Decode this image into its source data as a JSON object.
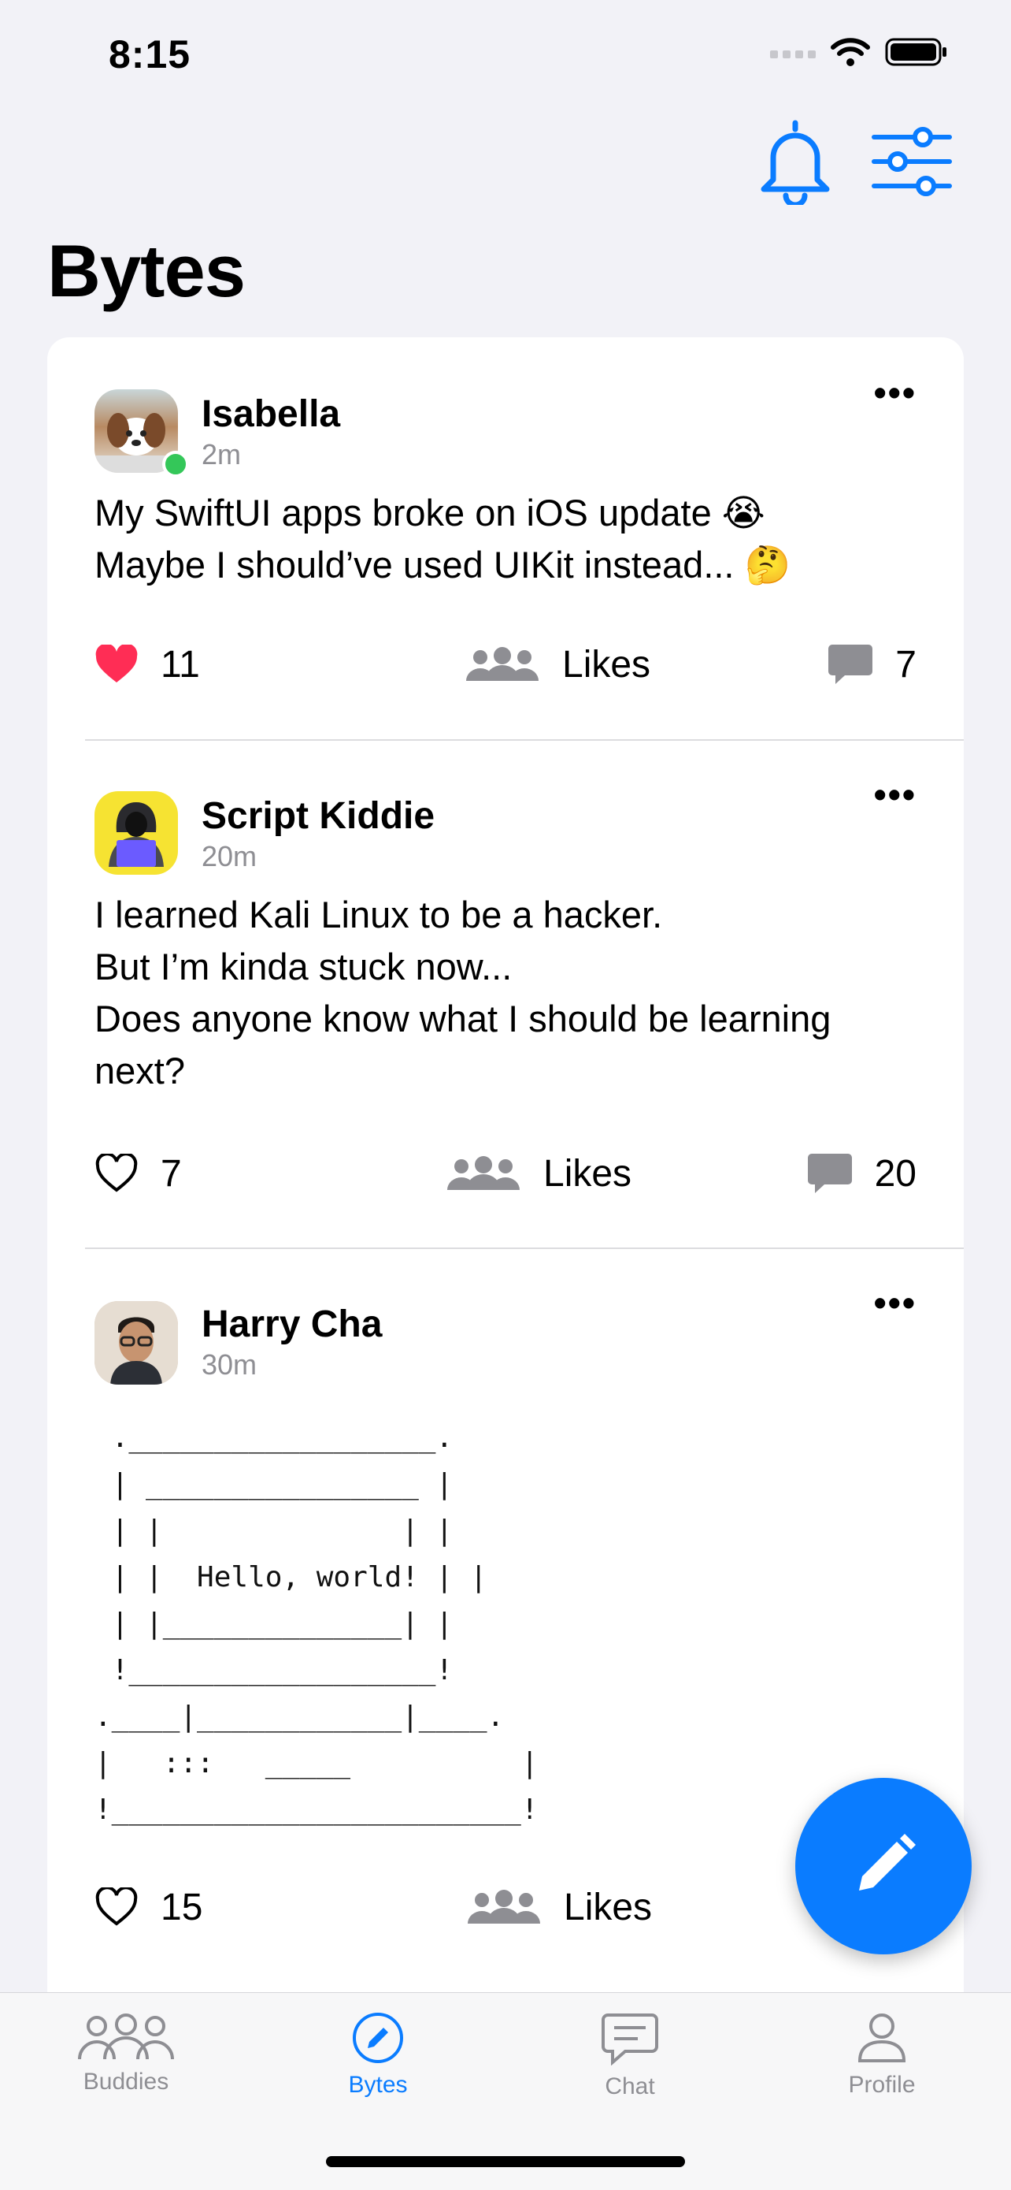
{
  "status_bar": {
    "time": "8:15"
  },
  "page": {
    "title": "Bytes"
  },
  "posts": [
    {
      "author": "Isabella",
      "time": "2m",
      "text": "My SwiftUI apps broke on iOS update 😭\nMaybe I should’ve used UIKit instead... 🤔",
      "likes": "11",
      "likes_label": "Likes",
      "comments": "7",
      "liked": true
    },
    {
      "author": "Script Kiddie",
      "time": "20m",
      "text": "I learned Kali Linux to be a hacker.\nBut I’m kinda stuck now...\nDoes anyone know what I should be learning next?",
      "likes": "7",
      "likes_label": "Likes",
      "comments": "20",
      "liked": false
    },
    {
      "author": "Harry Cha",
      "time": "30m",
      "ascii": " .__________________.\n | ________________ |\n | |              | |\n | |  Hello, world! | |\n | |______________| |\n !__________________!\n.____|____________|____.\n|   :::   _____          |\n!________________________!",
      "likes": "15",
      "likes_label": "Likes",
      "comments": "",
      "liked": false
    }
  ],
  "tabs": [
    {
      "label": "Buddies",
      "icon": "buddies-icon"
    },
    {
      "label": "Bytes",
      "icon": "bytes-icon"
    },
    {
      "label": "Chat",
      "icon": "chat-icon"
    },
    {
      "label": "Profile",
      "icon": "profile-icon"
    }
  ],
  "colors": {
    "accent": "#0a7cff",
    "heart": "#ff2d55",
    "online": "#34c759"
  }
}
